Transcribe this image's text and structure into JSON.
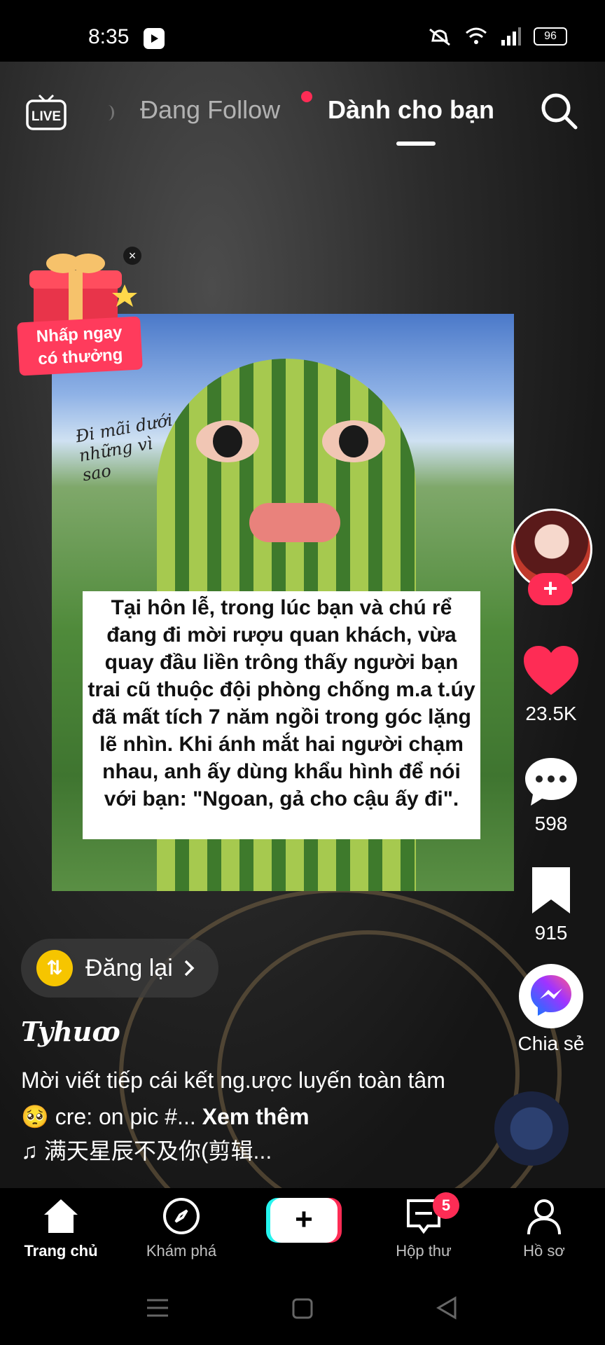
{
  "status_bar": {
    "time": "8:35",
    "battery": "96",
    "icons": [
      "youtube-icon",
      "mute-icon",
      "wifi-icon",
      "signal-icon",
      "battery-icon"
    ]
  },
  "top_nav": {
    "tabs": [
      {
        "label": "Đang Follow",
        "active": false,
        "has_dot": true
      },
      {
        "label": "Dành cho bạn",
        "active": true
      }
    ],
    "live_icon": "live-icon",
    "search_icon": "search-icon"
  },
  "promo": {
    "label_line1": "Nhấp ngay",
    "label_line2": "có thưởng"
  },
  "post_image": {
    "handwriting": "Đi mãi dưới những vì sao",
    "text": "Tại hôn lễ, trong lúc bạn và chú rể đang đi mời rượu quan khách, vừa quay đầu liền trông thấy người bạn trai cũ thuộc đội phòng chống m.a t.úy đã mất tích 7 năm ngồi trong góc lặng lẽ nhìn. Khi ánh mắt hai người chạm nhau, anh ấy dùng khẩu hình để nói với bạn: \"Ngoan, gả cho cậu ấy đi\"."
  },
  "right_rail": {
    "likes": "23.5K",
    "comments": "598",
    "bookmarks": "915",
    "share_label": "Chia sẻ",
    "follow_symbol": "+"
  },
  "post": {
    "repost_label": "Đăng lại",
    "username": "Tyhuꝏ",
    "caption": "Mời viết tiếp cái kết ng.ược luyến toàn tâm 🥺 cre: on pic #...",
    "see_more": "Xem thêm",
    "music": "♫ 满天星辰不及你(剪辑..."
  },
  "bottom_nav": {
    "items": [
      {
        "label": "Trang chủ",
        "icon": "home-icon",
        "active": true
      },
      {
        "label": "Khám phá",
        "icon": "compass-icon",
        "active": false
      },
      {
        "label": "",
        "icon": "create-icon",
        "symbol": "+"
      },
      {
        "label": "Hộp thư",
        "icon": "inbox-icon",
        "badge": "5",
        "active": false
      },
      {
        "label": "Hồ sơ",
        "icon": "profile-icon",
        "active": false
      }
    ]
  },
  "colors": {
    "accent": "#fe2c55",
    "cyan": "#25f4ee",
    "repost_yellow": "#f6c500",
    "background": "#000000"
  }
}
